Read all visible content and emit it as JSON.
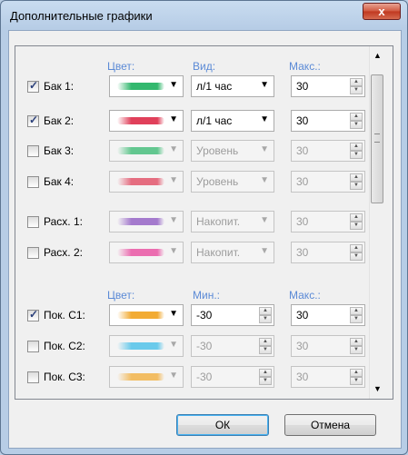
{
  "window": {
    "title": "Дополнительные графики",
    "close_glyph": "x"
  },
  "headers1": {
    "color": "Цвет:",
    "view": "Вид:",
    "max": "Макс.:"
  },
  "headers2": {
    "color": "Цвет:",
    "min": "Мин.:",
    "max": "Макс.:"
  },
  "rows": [
    {
      "label": "Бак 1:",
      "checked": true,
      "color": "#33b86e",
      "combo": "л/1 час",
      "value": "30",
      "enabled": true
    },
    {
      "label": "Бак 2:",
      "checked": true,
      "color": "#e0405a",
      "combo": "л/1 час",
      "value": "30",
      "enabled": true
    },
    {
      "label": "Бак 3:",
      "checked": false,
      "color": "#33b86e",
      "combo": "Уровень",
      "value": "30",
      "enabled": false
    },
    {
      "label": "Бак 4:",
      "checked": false,
      "color": "#e0405a",
      "combo": "Уровень",
      "value": "30",
      "enabled": false
    },
    {
      "label": "Расх. 1:",
      "checked": false,
      "color": "#8a52c0",
      "combo": "Накопит.",
      "value": "30",
      "enabled": false
    },
    {
      "label": "Расх. 2:",
      "checked": false,
      "color": "#e8409a",
      "combo": "Накопит.",
      "value": "30",
      "enabled": false
    },
    {
      "label": "Пок. С1:",
      "checked": true,
      "color": "#f2ab33",
      "min": "-30",
      "value": "30",
      "enabled": true
    },
    {
      "label": "Пок. С2:",
      "checked": false,
      "color": "#3cbce8",
      "min": "-30",
      "value": "30",
      "enabled": false
    },
    {
      "label": "Пок. С3:",
      "checked": false,
      "color": "#f2ab33",
      "min": "-30",
      "value": "30",
      "enabled": false
    }
  ],
  "buttons": {
    "ok": "ОК",
    "cancel": "Отмена"
  }
}
